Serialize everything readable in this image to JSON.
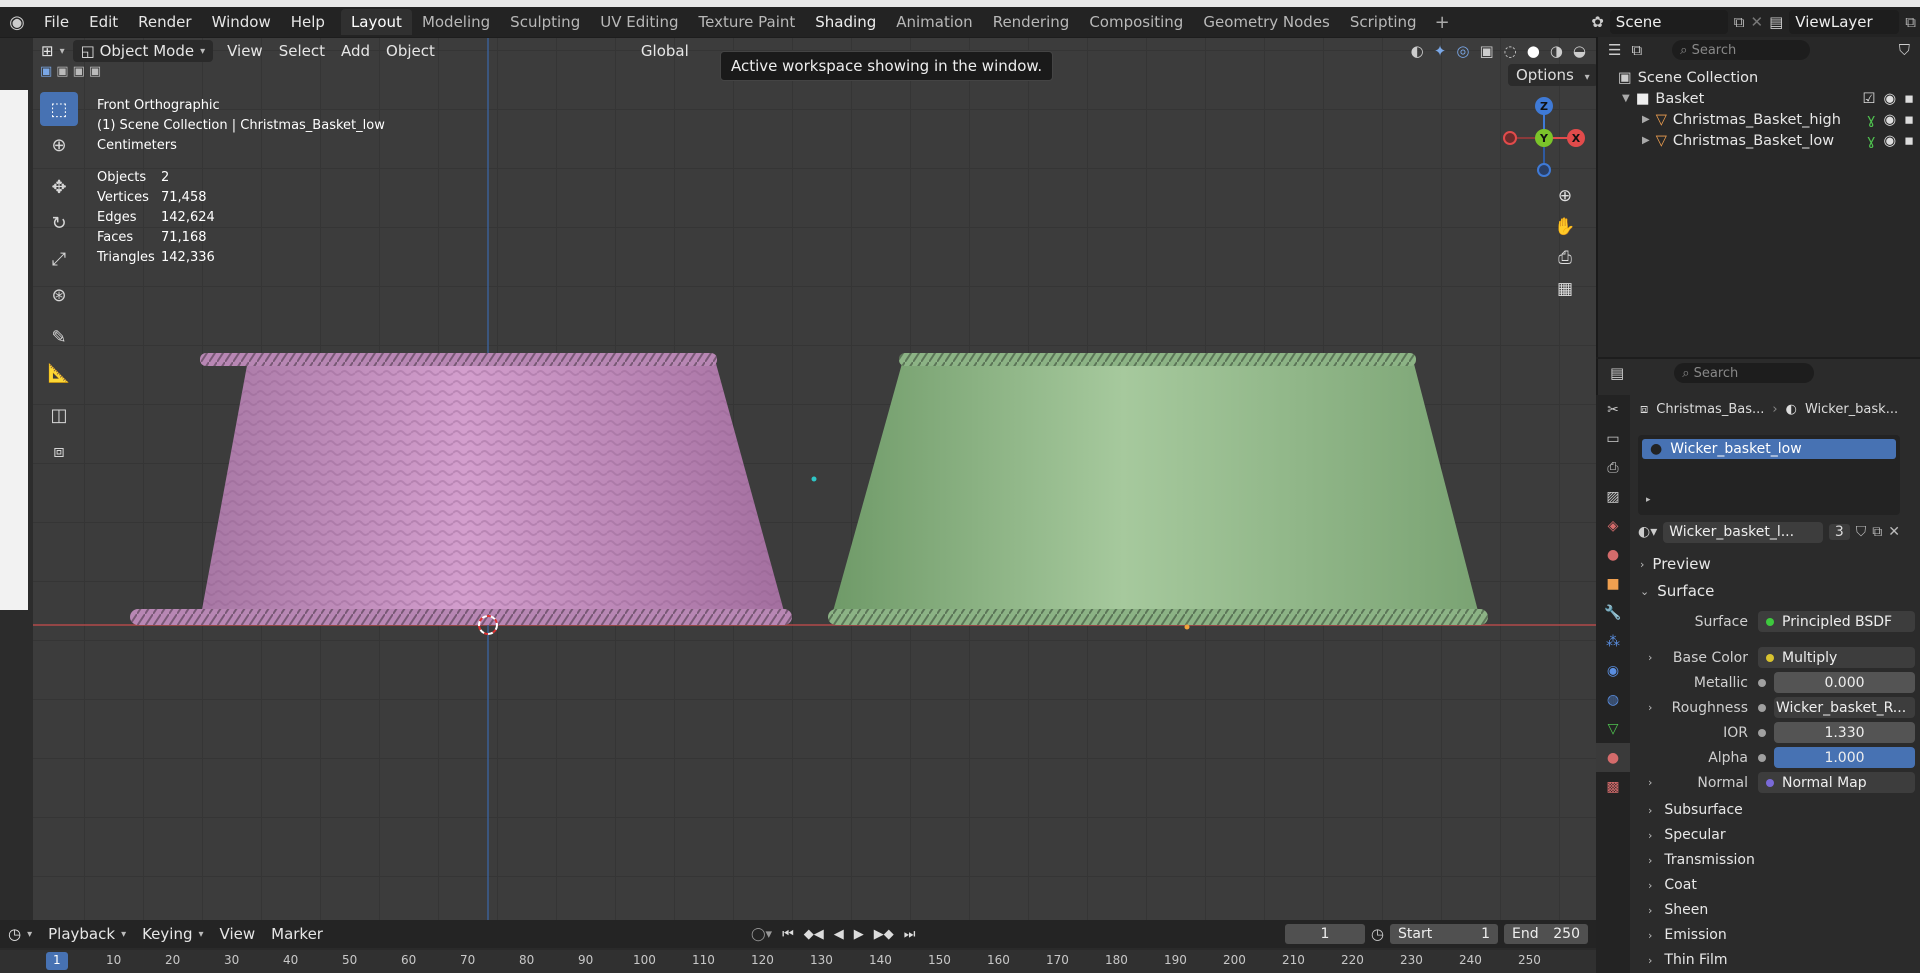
{
  "menubar": {
    "items": [
      "File",
      "Edit",
      "Render",
      "Window",
      "Help"
    ]
  },
  "workspaces": {
    "tabs": [
      "Layout",
      "Modeling",
      "Sculpting",
      "UV Editing",
      "Texture Paint",
      "Shading",
      "Animation",
      "Rendering",
      "Compositing",
      "Geometry Nodes",
      "Scripting"
    ],
    "active": "Layout",
    "add": "+"
  },
  "top_right": {
    "scene": "Scene",
    "view_layer": "ViewLayer"
  },
  "viewport": {
    "mode": "Object Mode",
    "menus": [
      "View",
      "Select",
      "Add",
      "Object"
    ],
    "transform_orientation": "Global",
    "tooltip": "Active workspace showing in the window.",
    "options": "Options",
    "view_name": "Front Orthographic",
    "collection": "(1) Scene Collection | Christmas_Basket_low",
    "units": "Centimeters",
    "stats": [
      {
        "label": "Objects",
        "value": "2"
      },
      {
        "label": "Vertices",
        "value": "71,458"
      },
      {
        "label": "Edges",
        "value": "142,624"
      },
      {
        "label": "Faces",
        "value": "71,168"
      },
      {
        "label": "Triangles",
        "value": "142,336"
      }
    ],
    "gizmo": {
      "z": "Z",
      "y": "Y",
      "x": "X"
    },
    "colors": {
      "high_basket": "#c48ac0",
      "low_basket": "#8fb888",
      "x_axis": "#c43c3c",
      "z_axis": "#3a6aa8"
    }
  },
  "outliner": {
    "search_placeholder": "Search",
    "root": "Scene Collection",
    "collection": "Basket",
    "objects": [
      "Christmas_Basket_high",
      "Christmas_Basket_low"
    ]
  },
  "properties": {
    "search_placeholder": "Search",
    "breadcrumb": {
      "object": "Christmas_Bas...",
      "material": "Wicker_bask..."
    },
    "slot": "Wicker_basket_low",
    "material_name": "Wicker_basket_l...",
    "user_count": "3",
    "panels": {
      "preview": "Preview",
      "surface": "Surface"
    },
    "surface_rows": [
      {
        "label": "Surface",
        "value": "Principled BSDF",
        "socket": "#3ec93e"
      },
      {
        "label": "Base Color",
        "value": "Multiply",
        "socket": "#d8c32f"
      },
      {
        "label": "Metallic",
        "value": "0.000",
        "socket": "#a0a0a0"
      },
      {
        "label": "Roughness",
        "value": "Wicker_basket_R...",
        "socket": "#a0a0a0"
      },
      {
        "label": "IOR",
        "value": "1.330",
        "socket": "#a0a0a0"
      },
      {
        "label": "Alpha",
        "value": "1.000",
        "socket": "#a0a0a0"
      },
      {
        "label": "Normal",
        "value": "Normal Map",
        "socket": "#7a6ad8"
      }
    ],
    "subpanels": [
      "Subsurface",
      "Specular",
      "Transmission",
      "Coat",
      "Sheen",
      "Emission",
      "Thin Film"
    ]
  },
  "timeline": {
    "menus": [
      "Playback",
      "Keying",
      "View",
      "Marker"
    ],
    "current_frame": "1",
    "start_label": "Start",
    "start": "1",
    "end_label": "End",
    "end": "250",
    "ruler": [
      "1",
      "10",
      "20",
      "30",
      "40",
      "50",
      "60",
      "70",
      "80",
      "90",
      "100",
      "110",
      "120",
      "130",
      "140",
      "150",
      "160",
      "170",
      "180",
      "190",
      "200",
      "210",
      "220",
      "230",
      "240",
      "250"
    ]
  }
}
